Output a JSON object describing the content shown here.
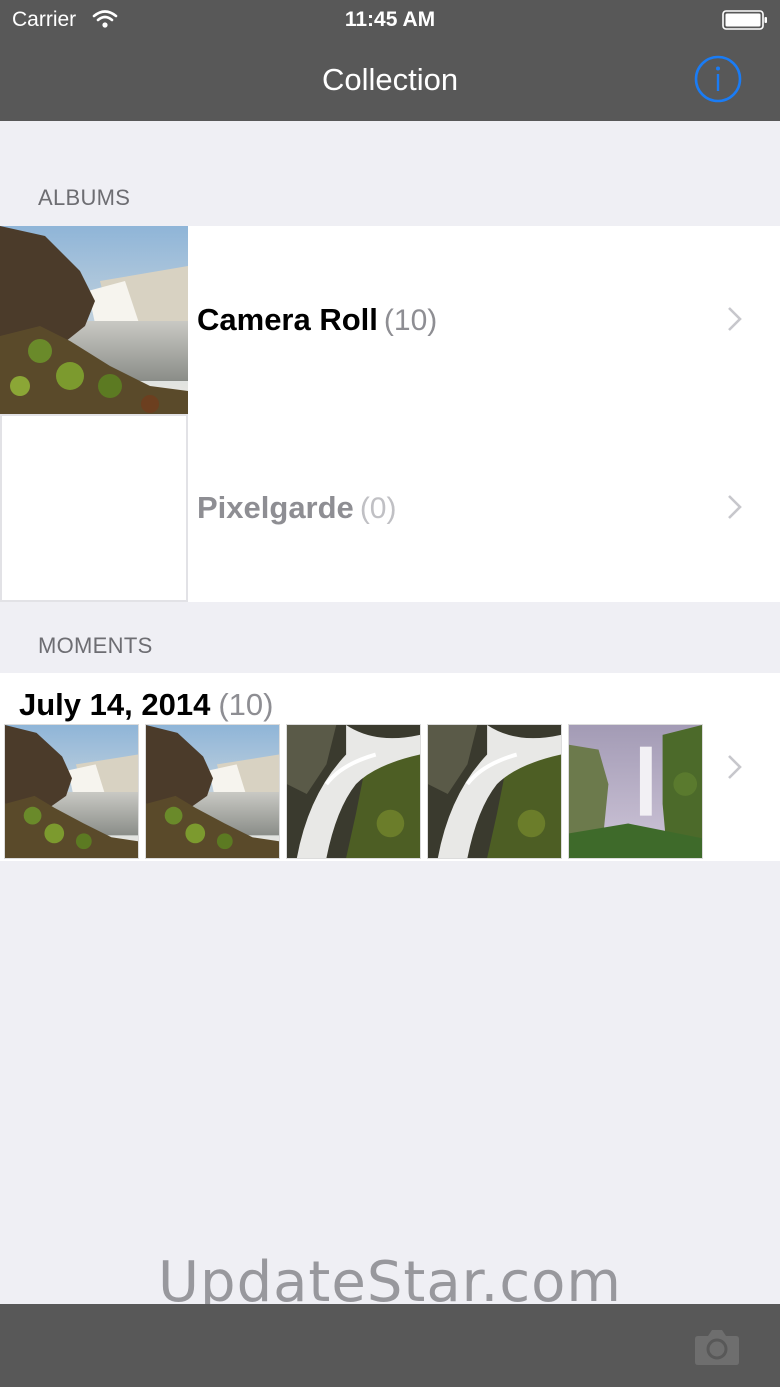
{
  "status_bar": {
    "carrier": "Carrier",
    "time": "11:45 AM"
  },
  "nav": {
    "title": "Collection",
    "info_icon": "info-icon"
  },
  "albums": {
    "header": "ALBUMS",
    "items": [
      {
        "name": "Camera Roll",
        "count": "(10)"
      },
      {
        "name": "Pixelgarde",
        "count": "(0)"
      }
    ]
  },
  "moments": {
    "header": "MOMENTS",
    "groups": [
      {
        "date": "July 14, 2014",
        "count": "(10)"
      }
    ]
  },
  "watermark": "UpdateStar.com",
  "toolbar": {
    "camera_icon": "camera-icon"
  },
  "colors": {
    "bar": "#585858",
    "background": "#efeff4",
    "accent": "#1a7cf5"
  }
}
